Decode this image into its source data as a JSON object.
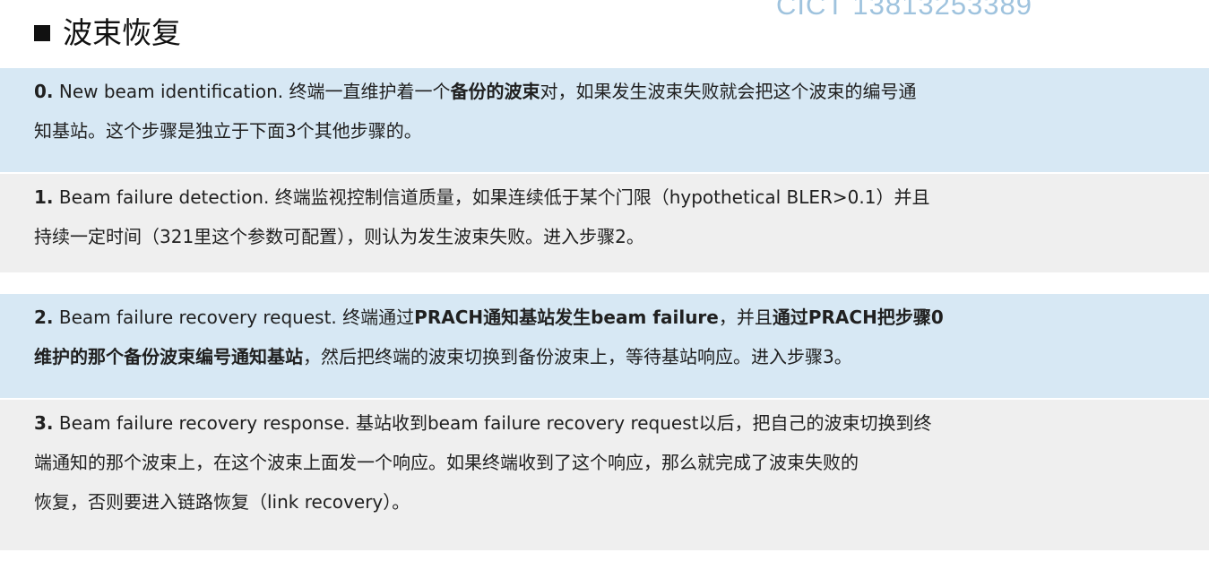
{
  "watermark": "CICT 13813253389",
  "title": "波束恢复",
  "steps": [
    {
      "num": "0.",
      "lines": [
        [
          {
            "text": " New beam identification. 终端一直维护着一个",
            "bold": false
          },
          {
            "text": "备份的波束",
            "bold": true
          },
          {
            "text": "对，如果发生波束失败就会把这个波束的编号通",
            "bold": false
          }
        ],
        [
          {
            "text": "知基站。这个步骤是独立于下面3个其他步骤的。",
            "bold": false
          }
        ]
      ]
    },
    {
      "num": "1.",
      "lines": [
        [
          {
            "text": " Beam failure detection. 终端监视控制信道质量，如果连续低于某个门限（hypothetical BLER>0.1）并且",
            "bold": false
          }
        ],
        [
          {
            "text": "持续一定时间（321里这个参数可配置），则认为发生波束失败。进入步骤2。",
            "bold": false
          }
        ]
      ]
    },
    {
      "num": "2.",
      "lines": [
        [
          {
            "text": " Beam failure recovery request. 终端通过",
            "bold": false
          },
          {
            "text": "PRACH通知基站发生beam failure",
            "bold": true
          },
          {
            "text": "，并且",
            "bold": false
          },
          {
            "text": "通过PRACH把步骤0",
            "bold": true
          }
        ],
        [
          {
            "text": "维护的那个备份波束编号通知基站",
            "bold": true
          },
          {
            "text": "，然后把终端的波束切换到备份波束上，等待基站响应。进入步骤3。",
            "bold": false
          }
        ]
      ]
    },
    {
      "num": "3.",
      "lines": [
        [
          {
            "text": " Beam failure recovery response. 基站收到beam failure recovery request以后，把自己的波束切换到终",
            "bold": false
          }
        ],
        [
          {
            "text": "端通知的那个波束上，在这个波束上面发一个响应。如果终端收到了这个响应，那么就完成了波束失败的",
            "bold": false
          }
        ],
        [
          {
            "text": "恢复，否则要进入链路恢复（link recovery）。",
            "bold": false
          }
        ]
      ]
    }
  ]
}
